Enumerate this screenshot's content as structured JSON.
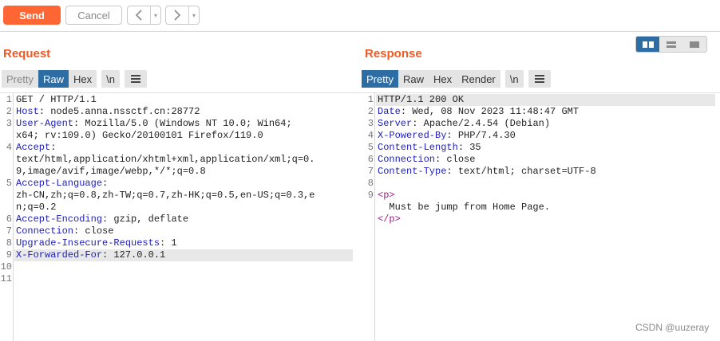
{
  "toolbar": {
    "send_label": "Send",
    "cancel_label": "Cancel",
    "back_glyph": "<",
    "forward_glyph": ">",
    "dropdown_glyph": "▾"
  },
  "layout_buttons": [
    "split-columns-icon",
    "split-rows-icon",
    "single-pane-icon"
  ],
  "request": {
    "title": "Request",
    "tabs": [
      "Pretty",
      "Raw",
      "Hex"
    ],
    "active_tab": "Raw",
    "newline_label": "\\n",
    "menu_icon": "hamburger-icon",
    "lines": [
      {
        "n": "1",
        "key": "",
        "val": "GET / HTTP/1.1"
      },
      {
        "n": "2",
        "key": "Host",
        "val": ": node5.anna.nssctf.cn:28772"
      },
      {
        "n": "3",
        "key": "User-Agent",
        "val": ": Mozilla/5.0 (Windows NT 10.0; Win64;"
      },
      {
        "n": "",
        "key": "",
        "val": "x64; rv:109.0) Gecko/20100101 Firefox/119.0"
      },
      {
        "n": "4",
        "key": "Accept",
        "val": ":"
      },
      {
        "n": "",
        "key": "",
        "val": "text/html,application/xhtml+xml,application/xml;q=0."
      },
      {
        "n": "",
        "key": "",
        "val": "9,image/avif,image/webp,*/*;q=0.8"
      },
      {
        "n": "5",
        "key": "Accept-Language",
        "val": ":"
      },
      {
        "n": "",
        "key": "",
        "val": "zh-CN,zh;q=0.8,zh-TW;q=0.7,zh-HK;q=0.5,en-US;q=0.3,e"
      },
      {
        "n": "",
        "key": "",
        "val": "n;q=0.2"
      },
      {
        "n": "6",
        "key": "Accept-Encoding",
        "val": ": gzip, deflate"
      },
      {
        "n": "7",
        "key": "Connection",
        "val": ": close"
      },
      {
        "n": "8",
        "key": "Upgrade-Insecure-Requests",
        "val": ": 1"
      },
      {
        "n": "9",
        "key": "X-Forwarded-For",
        "val": ": 127.0.0.1"
      },
      {
        "n": "10",
        "key": "",
        "val": ""
      },
      {
        "n": "11",
        "key": "",
        "val": ""
      }
    ]
  },
  "response": {
    "title": "Response",
    "tabs": [
      "Pretty",
      "Raw",
      "Hex",
      "Render"
    ],
    "active_tab": "Pretty",
    "newline_label": "\\n",
    "menu_icon": "hamburger-icon",
    "lines": [
      {
        "n": "1",
        "key": "",
        "val": "HTTP/1.1 200 OK"
      },
      {
        "n": "2",
        "key": "Date",
        "val": ": Wed, 08 Nov 2023 11:48:47 GMT"
      },
      {
        "n": "3",
        "key": "Server",
        "val": ": Apache/2.4.54 (Debian)"
      },
      {
        "n": "4",
        "key": "X-Powered-By",
        "val": ": PHP/7.4.30"
      },
      {
        "n": "5",
        "key": "Content-Length",
        "val": ": 35"
      },
      {
        "n": "6",
        "key": "Connection",
        "val": ": close"
      },
      {
        "n": "7",
        "key": "Content-Type",
        "val": ": text/html; charset=UTF-8"
      },
      {
        "n": "8",
        "key": "",
        "val": ""
      },
      {
        "n": "9",
        "key": "",
        "val": "",
        "tag_open": "<p>"
      },
      {
        "n": "",
        "key": "",
        "val": "  Must be jump from Home Page."
      },
      {
        "n": "",
        "key": "",
        "val": "",
        "tag_close": "</p>"
      }
    ]
  },
  "watermark": "CSDN @uuzeray",
  "colors": {
    "accent": "#ff6633",
    "title": "#f15a24",
    "active_tab": "#2e6da4",
    "header_key": "#1c1cc0",
    "tag": "#a01a8c"
  }
}
